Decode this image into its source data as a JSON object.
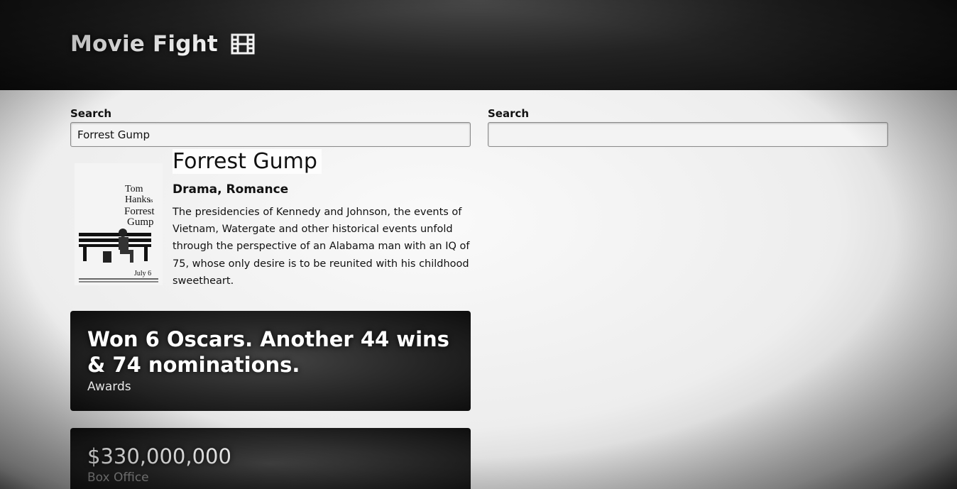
{
  "header": {
    "brand_title": "Movie Fight",
    "brand_icon": "film-icon"
  },
  "left_search": {
    "label": "Search",
    "value": "Forrest Gump",
    "placeholder": ""
  },
  "right_search": {
    "label": "Search",
    "value": "",
    "placeholder": ""
  },
  "movie": {
    "title": "Forrest Gump",
    "genre": "Drama, Romance",
    "plot": "The presidencies of Kennedy and Johnson, the events of Vietnam, Watergate and other historical events unfold through the perspective of an Alabama man with an IQ of 75, whose only desire is to be reunited with his childhood sweetheart.",
    "poster": {
      "line1": "Tom",
      "line2": "Hanks",
      "line2_suffix": "is",
      "line3": "Forrest",
      "line4": "Gump",
      "date": "July 6"
    }
  },
  "stats": [
    {
      "value": "Won 6 Oscars. Another 44 wins & 74 nominations.",
      "label": "Awards"
    },
    {
      "value": "$330,000,000",
      "label": "Box Office"
    }
  ],
  "colors": {
    "hero_dark": "#0a0a0a",
    "card_dark": "#252525",
    "page_bg": "#f2f2f2"
  }
}
